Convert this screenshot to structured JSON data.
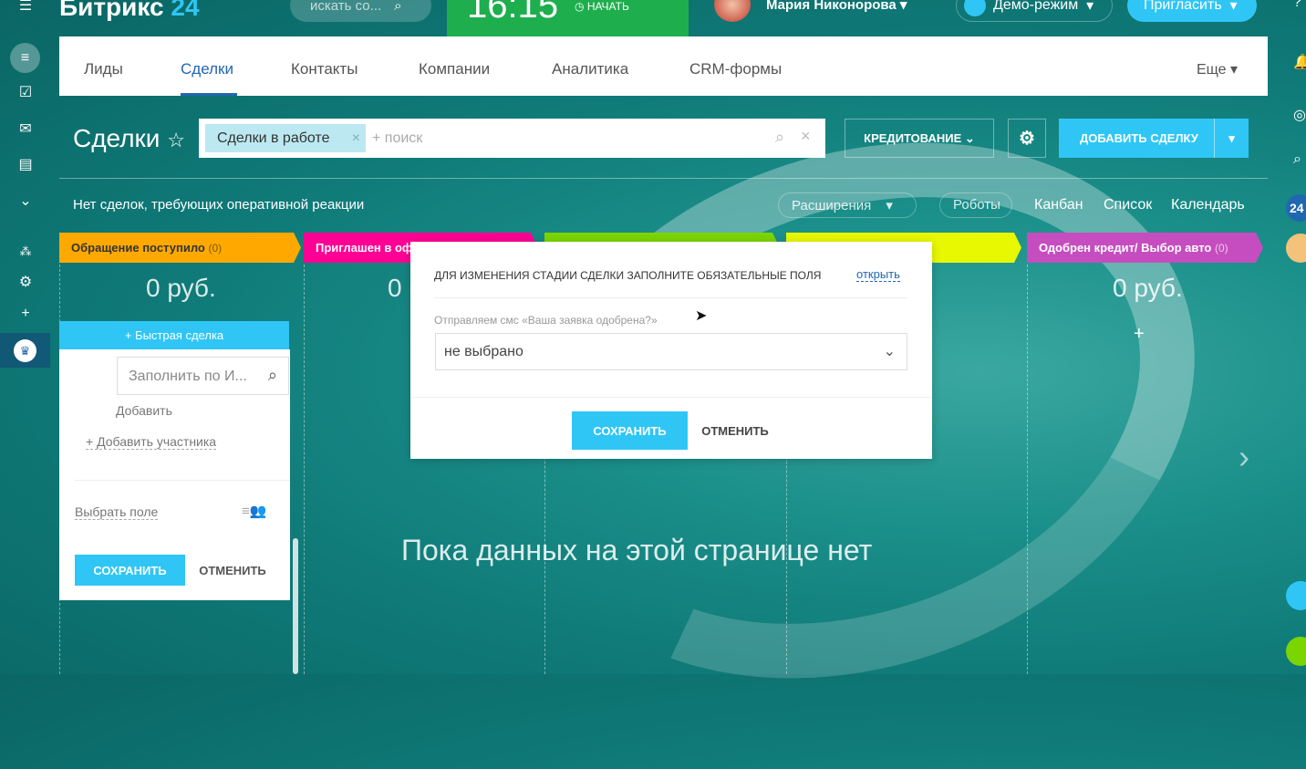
{
  "topbar": {
    "logo_main": "Битрикс",
    "logo_num": "24",
    "search_placeholder": "искать со...",
    "time": "16:15",
    "start_label": "НАЧАТЬ",
    "user_name": "Мария Никонорова",
    "demo_label": "Демо-режим",
    "invite_label": "Пригласить"
  },
  "nav": {
    "tabs": [
      {
        "label": "Лиды"
      },
      {
        "label": "Сделки",
        "active": true
      },
      {
        "label": "Контакты"
      },
      {
        "label": "Компании"
      },
      {
        "label": "Аналитика"
      },
      {
        "label": "CRM-формы"
      }
    ],
    "more": "Еще"
  },
  "toolbar": {
    "title": "Сделки",
    "filter_tag": "Сделки в работе",
    "search_placeholder": "+ поиск",
    "category": "КРЕДИТОВАНИЕ",
    "add_deal": "ДОБАВИТЬ СДЕЛКУ"
  },
  "subbar": {
    "notice": "Нет сделок, требующих оперативной реакции",
    "extensions": "Расширения",
    "robots": "Роботы",
    "kanban": "Канбан",
    "list": "Список",
    "calendar": "Календарь"
  },
  "stages": [
    {
      "name": "Обращение поступило",
      "count": "(0)",
      "color": "#ffa900",
      "text": "#333",
      "sum": "0 руб."
    },
    {
      "name": "Приглашен в оф",
      "count": "",
      "color": "#ff0094",
      "text": "#fff",
      "sum": "0"
    },
    {
      "name": "",
      "count": "",
      "color": "#7bd500",
      "text": "#fff",
      "sum": ""
    },
    {
      "name": "",
      "count": "",
      "color": "#e8f800",
      "text": "#333",
      "sum": ""
    },
    {
      "name": "Одобрен кредит/ Выбор авто",
      "count": "(0)",
      "color": "#c54dbf",
      "text": "#fff",
      "sum": "0 руб."
    }
  ],
  "quick": {
    "button": "+ Быстрая сделка",
    "search_placeholder": "Заполнить по И...",
    "add": "Добавить",
    "add_participant": "+ Добавить участника",
    "choose_field": "Выбрать поле",
    "save": "СОХРАНИТЬ",
    "cancel": "ОТМЕНИТЬ"
  },
  "modal": {
    "title": "ДЛЯ ИЗМЕНЕНИЯ СТАДИИ СДЕЛКИ ЗАПОЛНИТЕ ОБЯЗАТЕЛЬНЫЕ ПОЛЯ",
    "open": "открыть",
    "field_label": "Отправляем смс «Ваша заявка одобрена?»",
    "field_value": "не выбрано",
    "save": "СОХРАНИТЬ",
    "cancel": "ОТМЕНИТЬ"
  },
  "empty": "Пока данных на этой странице нет",
  "colors": {
    "accent": "#2fc6f6",
    "active_tab": "#2067b0",
    "clock_bg": "#1eae4e"
  }
}
